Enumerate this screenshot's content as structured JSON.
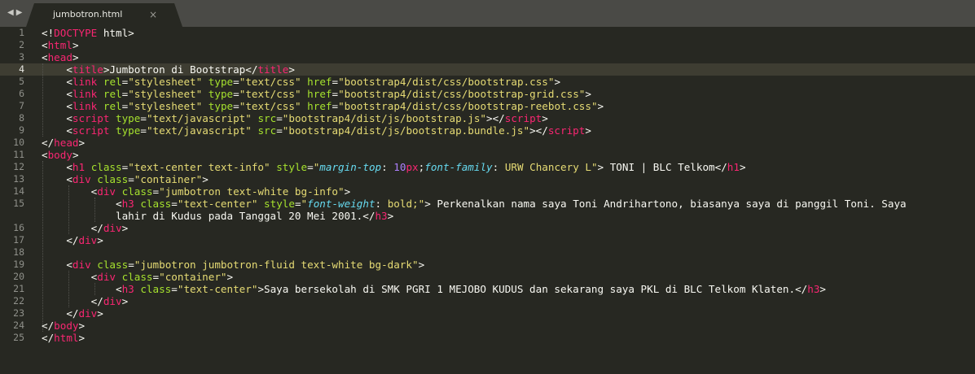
{
  "tab": {
    "title": "jumbotron.html",
    "close_glyph": "×"
  },
  "colors": {
    "background": "#272822",
    "tag": "#f92672",
    "attribute": "#a6e22e",
    "string": "#e6db74",
    "css_property": "#66d9ef",
    "number": "#ae81ff",
    "text": "#f8f8f2"
  },
  "current_line": 4,
  "lines": [
    {
      "no": "1",
      "tokens": [
        {
          "c": "p",
          "v": "<!"
        },
        {
          "c": "t",
          "v": "DOCTYPE"
        },
        {
          "c": "p",
          "v": " html>"
        }
      ]
    },
    {
      "no": "2",
      "tokens": [
        {
          "c": "p",
          "v": "<"
        },
        {
          "c": "t",
          "v": "html"
        },
        {
          "c": "p",
          "v": ">"
        }
      ]
    },
    {
      "no": "3",
      "tokens": [
        {
          "c": "p",
          "v": "<"
        },
        {
          "c": "t",
          "v": "head"
        },
        {
          "c": "p",
          "v": ">"
        }
      ]
    },
    {
      "no": "4",
      "tokens": [
        {
          "c": "p",
          "v": "    <"
        },
        {
          "c": "t",
          "v": "title"
        },
        {
          "c": "p",
          "v": ">Jumbotron di Bootstrap</"
        },
        {
          "c": "t",
          "v": "title"
        },
        {
          "c": "p",
          "v": ">"
        }
      ]
    },
    {
      "no": "5",
      "tokens": [
        {
          "c": "p",
          "v": "    <"
        },
        {
          "c": "t",
          "v": "link"
        },
        {
          "c": "p",
          "v": " "
        },
        {
          "c": "a",
          "v": "rel"
        },
        {
          "c": "p",
          "v": "="
        },
        {
          "c": "s",
          "v": "\"stylesheet\""
        },
        {
          "c": "p",
          "v": " "
        },
        {
          "c": "a",
          "v": "type"
        },
        {
          "c": "p",
          "v": "="
        },
        {
          "c": "s",
          "v": "\"text/css\""
        },
        {
          "c": "p",
          "v": " "
        },
        {
          "c": "a",
          "v": "href"
        },
        {
          "c": "p",
          "v": "="
        },
        {
          "c": "s",
          "v": "\"bootstrap4/dist/css/bootstrap.css\""
        },
        {
          "c": "p",
          "v": ">"
        }
      ]
    },
    {
      "no": "6",
      "tokens": [
        {
          "c": "p",
          "v": "    <"
        },
        {
          "c": "t",
          "v": "link"
        },
        {
          "c": "p",
          "v": " "
        },
        {
          "c": "a",
          "v": "rel"
        },
        {
          "c": "p",
          "v": "="
        },
        {
          "c": "s",
          "v": "\"stylesheet\""
        },
        {
          "c": "p",
          "v": " "
        },
        {
          "c": "a",
          "v": "type"
        },
        {
          "c": "p",
          "v": "="
        },
        {
          "c": "s",
          "v": "\"text/css\""
        },
        {
          "c": "p",
          "v": " "
        },
        {
          "c": "a",
          "v": "href"
        },
        {
          "c": "p",
          "v": "="
        },
        {
          "c": "s",
          "v": "\"bootstrap4/dist/css/bootstrap-grid.css\""
        },
        {
          "c": "p",
          "v": ">"
        }
      ]
    },
    {
      "no": "7",
      "tokens": [
        {
          "c": "p",
          "v": "    <"
        },
        {
          "c": "t",
          "v": "link"
        },
        {
          "c": "p",
          "v": " "
        },
        {
          "c": "a",
          "v": "rel"
        },
        {
          "c": "p",
          "v": "="
        },
        {
          "c": "s",
          "v": "\"stylesheet\""
        },
        {
          "c": "p",
          "v": " "
        },
        {
          "c": "a",
          "v": "type"
        },
        {
          "c": "p",
          "v": "="
        },
        {
          "c": "s",
          "v": "\"text/css\""
        },
        {
          "c": "p",
          "v": " "
        },
        {
          "c": "a",
          "v": "href"
        },
        {
          "c": "p",
          "v": "="
        },
        {
          "c": "s",
          "v": "\"bootstrap4/dist/css/bootstrap-reebot.css\""
        },
        {
          "c": "p",
          "v": ">"
        }
      ]
    },
    {
      "no": "8",
      "tokens": [
        {
          "c": "p",
          "v": "    <"
        },
        {
          "c": "t",
          "v": "script"
        },
        {
          "c": "p",
          "v": " "
        },
        {
          "c": "a",
          "v": "type"
        },
        {
          "c": "p",
          "v": "="
        },
        {
          "c": "s",
          "v": "\"text/javascript\""
        },
        {
          "c": "p",
          "v": " "
        },
        {
          "c": "a",
          "v": "src"
        },
        {
          "c": "p",
          "v": "="
        },
        {
          "c": "s",
          "v": "\"bootstrap4/dist/js/bootstrap.js\""
        },
        {
          "c": "p",
          "v": "></"
        },
        {
          "c": "t",
          "v": "script"
        },
        {
          "c": "p",
          "v": ">"
        }
      ]
    },
    {
      "no": "9",
      "tokens": [
        {
          "c": "p",
          "v": "    <"
        },
        {
          "c": "t",
          "v": "script"
        },
        {
          "c": "p",
          "v": " "
        },
        {
          "c": "a",
          "v": "type"
        },
        {
          "c": "p",
          "v": "="
        },
        {
          "c": "s",
          "v": "\"text/javascript\""
        },
        {
          "c": "p",
          "v": " "
        },
        {
          "c": "a",
          "v": "src"
        },
        {
          "c": "p",
          "v": "="
        },
        {
          "c": "s",
          "v": "\"bootstrap4/dist/js/bootstrap.bundle.js\""
        },
        {
          "c": "p",
          "v": "></"
        },
        {
          "c": "t",
          "v": "script"
        },
        {
          "c": "p",
          "v": ">"
        }
      ]
    },
    {
      "no": "10",
      "tokens": [
        {
          "c": "p",
          "v": "</"
        },
        {
          "c": "t",
          "v": "head"
        },
        {
          "c": "p",
          "v": ">"
        }
      ]
    },
    {
      "no": "11",
      "tokens": [
        {
          "c": "p",
          "v": "<"
        },
        {
          "c": "t",
          "v": "body"
        },
        {
          "c": "p",
          "v": ">"
        }
      ]
    },
    {
      "no": "12",
      "tokens": [
        {
          "c": "p",
          "v": "    <"
        },
        {
          "c": "t",
          "v": "h1"
        },
        {
          "c": "p",
          "v": " "
        },
        {
          "c": "a",
          "v": "class"
        },
        {
          "c": "p",
          "v": "="
        },
        {
          "c": "s",
          "v": "\"text-center text-info\""
        },
        {
          "c": "p",
          "v": " "
        },
        {
          "c": "a",
          "v": "style"
        },
        {
          "c": "p",
          "v": "="
        },
        {
          "c": "s",
          "v": "\""
        },
        {
          "c": "i",
          "v": "margin-top"
        },
        {
          "c": "p",
          "v": ": "
        },
        {
          "c": "n",
          "v": "10"
        },
        {
          "c": "t",
          "v": "px"
        },
        {
          "c": "p",
          "v": ";"
        },
        {
          "c": "i",
          "v": "font-family"
        },
        {
          "c": "p",
          "v": ": "
        },
        {
          "c": "s",
          "v": "URW Chancery L\""
        },
        {
          "c": "p",
          "v": "> TONI | BLC Telkom</"
        },
        {
          "c": "t",
          "v": "h1"
        },
        {
          "c": "p",
          "v": ">"
        }
      ]
    },
    {
      "no": "13",
      "tokens": [
        {
          "c": "p",
          "v": "    <"
        },
        {
          "c": "t",
          "v": "div"
        },
        {
          "c": "p",
          "v": " "
        },
        {
          "c": "a",
          "v": "class"
        },
        {
          "c": "p",
          "v": "="
        },
        {
          "c": "s",
          "v": "\"container\""
        },
        {
          "c": "p",
          "v": ">"
        }
      ]
    },
    {
      "no": "14",
      "tokens": [
        {
          "c": "p",
          "v": "        <"
        },
        {
          "c": "t",
          "v": "div"
        },
        {
          "c": "p",
          "v": " "
        },
        {
          "c": "a",
          "v": "class"
        },
        {
          "c": "p",
          "v": "="
        },
        {
          "c": "s",
          "v": "\"jumbotron text-white bg-info\""
        },
        {
          "c": "p",
          "v": ">"
        }
      ]
    },
    {
      "no": "15",
      "tokens": [
        {
          "c": "p",
          "v": "            <"
        },
        {
          "c": "t",
          "v": "h3"
        },
        {
          "c": "p",
          "v": " "
        },
        {
          "c": "a",
          "v": "class"
        },
        {
          "c": "p",
          "v": "="
        },
        {
          "c": "s",
          "v": "\"text-center\""
        },
        {
          "c": "p",
          "v": " "
        },
        {
          "c": "a",
          "v": "style"
        },
        {
          "c": "p",
          "v": "="
        },
        {
          "c": "s",
          "v": "\""
        },
        {
          "c": "i",
          "v": "font-weight"
        },
        {
          "c": "p",
          "v": ": "
        },
        {
          "c": "s",
          "v": "bold;\""
        },
        {
          "c": "p",
          "v": "> Perkenalkan nama saya Toni Andrihartono, biasanya saya di panggil Toni. Saya"
        }
      ]
    },
    {
      "no": "",
      "tokens": [
        {
          "c": "p",
          "v": "            lahir di Kudus pada Tanggal 20 Mei 2001.</"
        },
        {
          "c": "t",
          "v": "h3"
        },
        {
          "c": "p",
          "v": ">"
        }
      ]
    },
    {
      "no": "16",
      "tokens": [
        {
          "c": "p",
          "v": "        </"
        },
        {
          "c": "t",
          "v": "div"
        },
        {
          "c": "p",
          "v": ">"
        }
      ]
    },
    {
      "no": "17",
      "tokens": [
        {
          "c": "p",
          "v": "    </"
        },
        {
          "c": "t",
          "v": "div"
        },
        {
          "c": "p",
          "v": ">"
        }
      ]
    },
    {
      "no": "18",
      "tokens": [
        {
          "c": "p",
          "v": ""
        }
      ]
    },
    {
      "no": "19",
      "tokens": [
        {
          "c": "p",
          "v": "    <"
        },
        {
          "c": "t",
          "v": "div"
        },
        {
          "c": "p",
          "v": " "
        },
        {
          "c": "a",
          "v": "class"
        },
        {
          "c": "p",
          "v": "="
        },
        {
          "c": "s",
          "v": "\"jumbotron jumbotron-fluid text-white bg-dark\""
        },
        {
          "c": "p",
          "v": ">"
        }
      ]
    },
    {
      "no": "20",
      "tokens": [
        {
          "c": "p",
          "v": "        <"
        },
        {
          "c": "t",
          "v": "div"
        },
        {
          "c": "p",
          "v": " "
        },
        {
          "c": "a",
          "v": "class"
        },
        {
          "c": "p",
          "v": "="
        },
        {
          "c": "s",
          "v": "\"container\""
        },
        {
          "c": "p",
          "v": ">"
        }
      ]
    },
    {
      "no": "21",
      "tokens": [
        {
          "c": "p",
          "v": "            <"
        },
        {
          "c": "t",
          "v": "h3"
        },
        {
          "c": "p",
          "v": " "
        },
        {
          "c": "a",
          "v": "class"
        },
        {
          "c": "p",
          "v": "="
        },
        {
          "c": "s",
          "v": "\"text-center\""
        },
        {
          "c": "p",
          "v": ">Saya bersekolah di SMK PGRI 1 MEJOBO KUDUS dan sekarang saya PKL di BLC Telkom Klaten.</"
        },
        {
          "c": "t",
          "v": "h3"
        },
        {
          "c": "p",
          "v": ">"
        }
      ]
    },
    {
      "no": "22",
      "tokens": [
        {
          "c": "p",
          "v": "        </"
        },
        {
          "c": "t",
          "v": "div"
        },
        {
          "c": "p",
          "v": ">"
        }
      ]
    },
    {
      "no": "23",
      "tokens": [
        {
          "c": "p",
          "v": "    </"
        },
        {
          "c": "t",
          "v": "div"
        },
        {
          "c": "p",
          "v": ">"
        }
      ]
    },
    {
      "no": "24",
      "tokens": [
        {
          "c": "p",
          "v": "</"
        },
        {
          "c": "t",
          "v": "body"
        },
        {
          "c": "p",
          "v": ">"
        }
      ]
    },
    {
      "no": "25",
      "tokens": [
        {
          "c": "p",
          "v": "</"
        },
        {
          "c": "t",
          "v": "html"
        },
        {
          "c": "p",
          "v": ">"
        }
      ]
    }
  ]
}
